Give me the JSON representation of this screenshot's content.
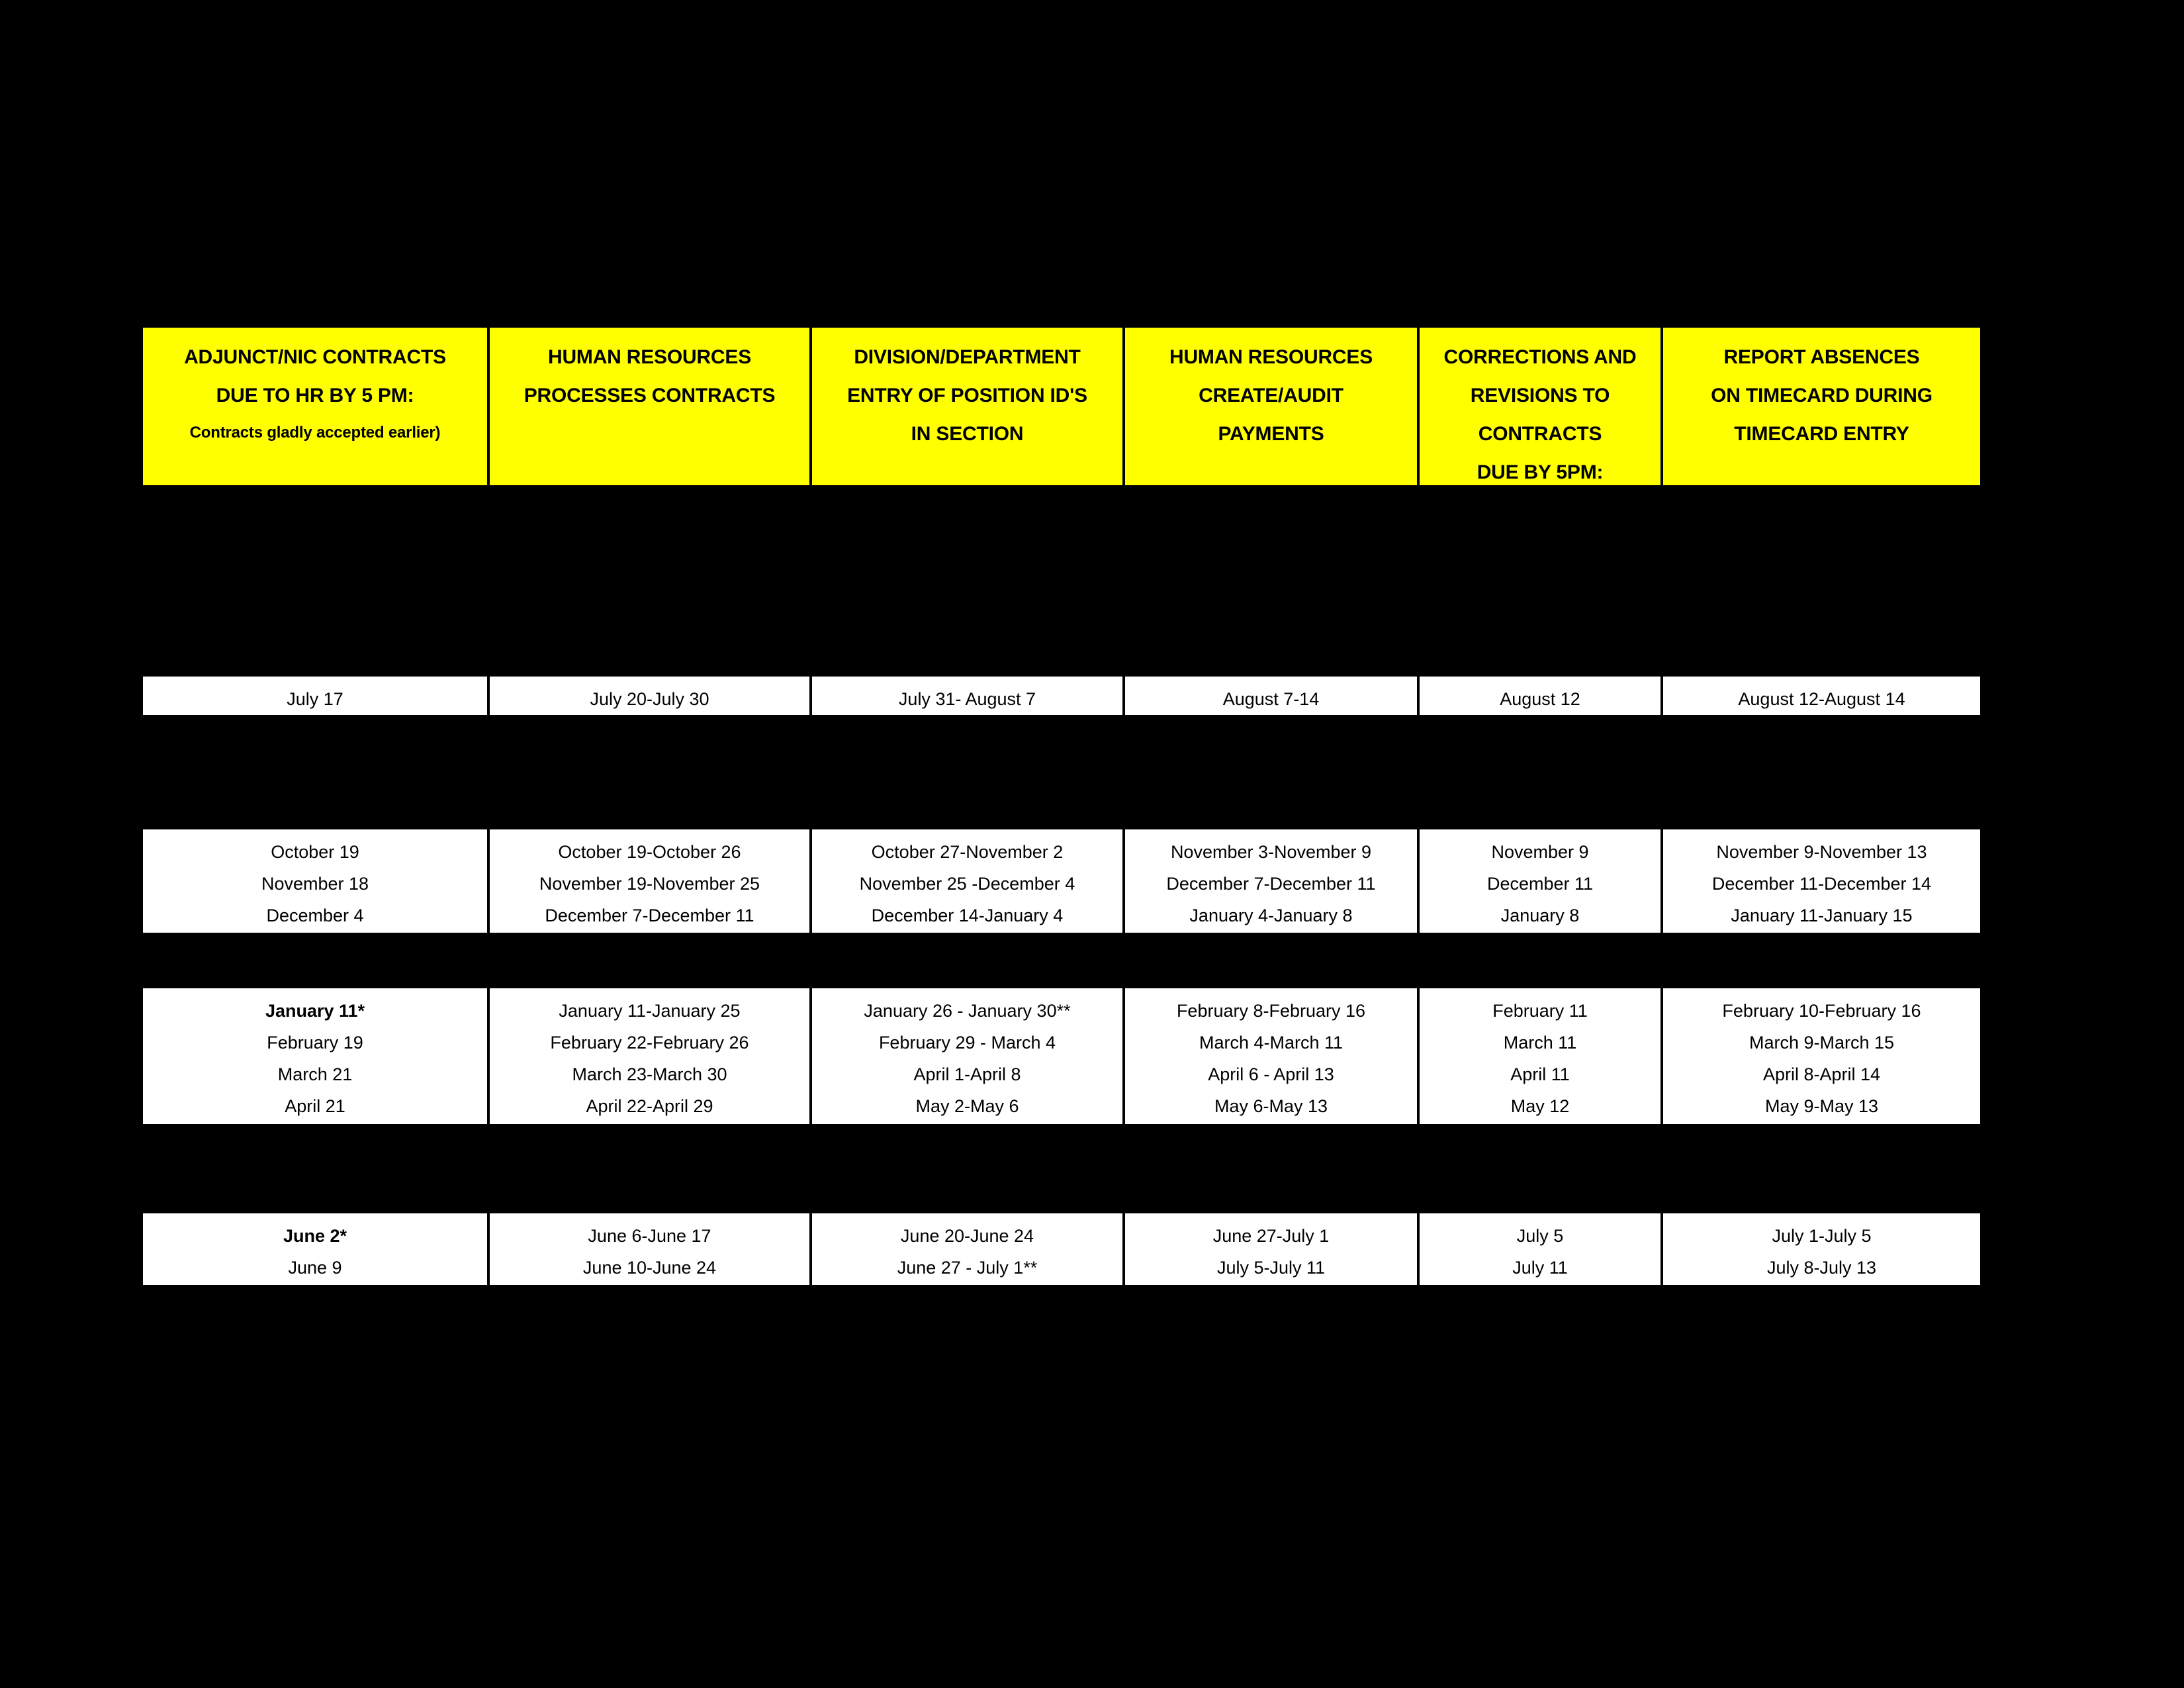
{
  "page": {
    "background_color": "#000000",
    "header_color": "#FFFF00",
    "cell_color": "#FFFFFF",
    "text_color": "#000000"
  },
  "columns": [
    {
      "id": "adjunct-nic-contracts",
      "lines": [
        {
          "text": "ADJUNCT/NIC CONTRACTS",
          "size": "normal"
        },
        {
          "text": "DUE TO HR BY 5 PM:",
          "size": "normal"
        },
        {
          "text": "Contracts gladly accepted earlier)",
          "size": "small"
        }
      ]
    },
    {
      "id": "human-resources-processes-contracts",
      "lines": [
        {
          "text": "HUMAN RESOURCES",
          "size": "normal"
        },
        {
          "text": "PROCESSES CONTRACTS",
          "size": "normal"
        }
      ]
    },
    {
      "id": "division-department-entry",
      "lines": [
        {
          "text": "DIVISION/DEPARTMENT",
          "size": "normal"
        },
        {
          "text": "ENTRY OF POSITION ID'S",
          "size": "normal"
        },
        {
          "text": "IN SECTION",
          "size": "normal"
        }
      ]
    },
    {
      "id": "human-resources-create-audit-payments",
      "lines": [
        {
          "text": "HUMAN RESOURCES",
          "size": "normal"
        },
        {
          "text": "CREATE/AUDIT",
          "size": "normal"
        },
        {
          "text": "PAYMENTS",
          "size": "normal"
        }
      ]
    },
    {
      "id": "corrections-and-revisions",
      "lines": [
        {
          "text": "CORRECTIONS AND",
          "size": "normal"
        },
        {
          "text": "REVISIONS TO",
          "size": "normal"
        },
        {
          "text": "CONTRACTS",
          "size": "normal"
        },
        {
          "text": "DUE BY 5PM:",
          "size": "normal"
        }
      ]
    },
    {
      "id": "report-absences-on-timecard",
      "lines": [
        {
          "text": "REPORT ABSENCES",
          "size": "normal"
        },
        {
          "text": "ON TIMECARD DURING",
          "size": "normal"
        },
        {
          "text": "TIMECARD ENTRY",
          "size": "normal"
        }
      ]
    }
  ],
  "blocks": [
    {
      "id": "block-summer-fall",
      "cells": [
        {
          "lines": [
            {
              "text": "July 17",
              "bold": false
            }
          ]
        },
        {
          "lines": [
            {
              "text": "July 20-July 30",
              "bold": false
            }
          ]
        },
        {
          "lines": [
            {
              "text": "July 31- August 7",
              "bold": false
            }
          ]
        },
        {
          "lines": [
            {
              "text": "August 7-14",
              "bold": false
            }
          ]
        },
        {
          "lines": [
            {
              "text": "August 12",
              "bold": false
            }
          ]
        },
        {
          "lines": [
            {
              "text": "August 12-August 14",
              "bold": false
            }
          ]
        }
      ]
    },
    {
      "id": "block-fall",
      "cells": [
        {
          "lines": [
            {
              "text": "October 19",
              "bold": false
            },
            {
              "text": "November 18",
              "bold": false
            },
            {
              "text": "December 4",
              "bold": false
            }
          ]
        },
        {
          "lines": [
            {
              "text": "October 19-October 26",
              "bold": false
            },
            {
              "text": "November 19-November 25",
              "bold": false
            },
            {
              "text": "December 7-December 11",
              "bold": false
            }
          ]
        },
        {
          "lines": [
            {
              "text": "October 27-November 2",
              "bold": false
            },
            {
              "text": "November 25 -December 4",
              "bold": false
            },
            {
              "text": "December 14-January 4",
              "bold": false
            }
          ]
        },
        {
          "lines": [
            {
              "text": "November 3-November 9",
              "bold": false
            },
            {
              "text": "December 7-December 11",
              "bold": false
            },
            {
              "text": "January 4-January 8",
              "bold": false
            }
          ]
        },
        {
          "lines": [
            {
              "text": "November 9",
              "bold": false
            },
            {
              "text": "December 11",
              "bold": false
            },
            {
              "text": "January 8",
              "bold": false
            }
          ]
        },
        {
          "lines": [
            {
              "text": "November 9-November 13",
              "bold": false
            },
            {
              "text": "December 11-December 14",
              "bold": false
            },
            {
              "text": "January 11-January 15",
              "bold": false
            }
          ]
        }
      ]
    },
    {
      "id": "block-spring",
      "cells": [
        {
          "lines": [
            {
              "text": "January 11*",
              "bold": true
            },
            {
              "text": "February 19",
              "bold": false
            },
            {
              "text": "March 21",
              "bold": false
            },
            {
              "text": "April 21",
              "bold": false
            }
          ]
        },
        {
          "lines": [
            {
              "text": "January 11-January 25",
              "bold": false
            },
            {
              "text": "February 22-February 26",
              "bold": false
            },
            {
              "text": "March 23-March 30",
              "bold": false
            },
            {
              "text": "April 22-April 29",
              "bold": false
            }
          ]
        },
        {
          "lines": [
            {
              "text": "January 26 - January 30**",
              "bold": false
            },
            {
              "text": "February 29 - March 4",
              "bold": false
            },
            {
              "text": "April 1-April 8",
              "bold": false
            },
            {
              "text": "May 2-May 6",
              "bold": false
            }
          ]
        },
        {
          "lines": [
            {
              "text": "February 8-February 16",
              "bold": false
            },
            {
              "text": "March 4-March 11",
              "bold": false
            },
            {
              "text": "April 6 - April 13",
              "bold": false
            },
            {
              "text": "May 6-May 13",
              "bold": false
            }
          ]
        },
        {
          "lines": [
            {
              "text": "February 11",
              "bold": false
            },
            {
              "text": "March 11",
              "bold": false
            },
            {
              "text": "April 11",
              "bold": false
            },
            {
              "text": "May 12",
              "bold": false
            }
          ]
        },
        {
          "lines": [
            {
              "text": "February 10-February 16",
              "bold": false
            },
            {
              "text": "March 9-March 15",
              "bold": false
            },
            {
              "text": "April 8-April 14",
              "bold": false
            },
            {
              "text": "May 9-May 13",
              "bold": false
            }
          ]
        }
      ]
    },
    {
      "id": "block-summer",
      "cells": [
        {
          "lines": [
            {
              "text": "June 2*",
              "bold": true
            },
            {
              "text": "June 9",
              "bold": false
            }
          ]
        },
        {
          "lines": [
            {
              "text": "June 6-June 17",
              "bold": false
            },
            {
              "text": "June 10-June 24",
              "bold": false
            }
          ]
        },
        {
          "lines": [
            {
              "text": "June 20-June 24",
              "bold": false
            },
            {
              "text": "June 27 - July 1**",
              "bold": false
            }
          ]
        },
        {
          "lines": [
            {
              "text": "June 27-July 1",
              "bold": false
            },
            {
              "text": "July 5-July 11",
              "bold": false
            }
          ]
        },
        {
          "lines": [
            {
              "text": "July 5",
              "bold": false
            },
            {
              "text": "July 11",
              "bold": false
            }
          ]
        },
        {
          "lines": [
            {
              "text": "July 1-July 5",
              "bold": false
            },
            {
              "text": "July 8-July 13",
              "bold": false
            }
          ]
        }
      ]
    }
  ]
}
